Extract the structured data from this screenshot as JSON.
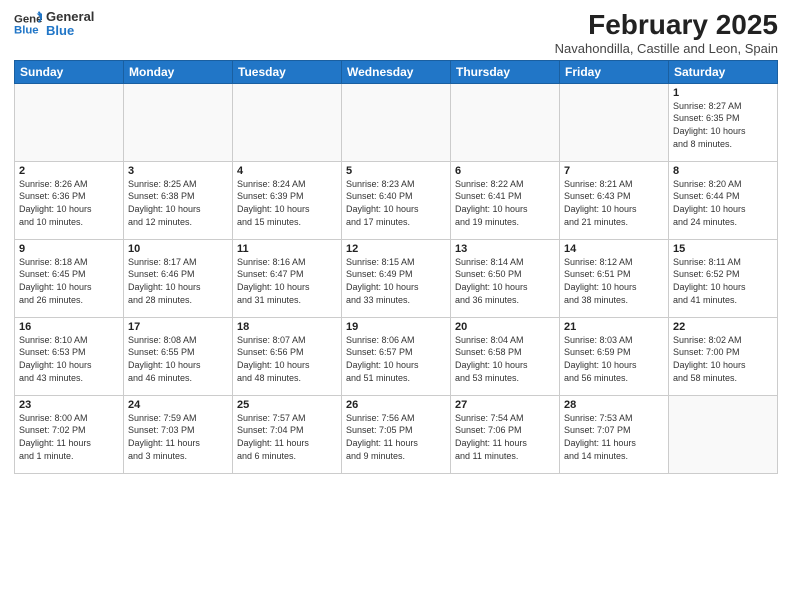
{
  "logo": {
    "line1": "General",
    "line2": "Blue"
  },
  "title": "February 2025",
  "subtitle": "Navahondilla, Castille and Leon, Spain",
  "weekdays": [
    "Sunday",
    "Monday",
    "Tuesday",
    "Wednesday",
    "Thursday",
    "Friday",
    "Saturday"
  ],
  "weeks": [
    [
      {
        "day": "",
        "info": ""
      },
      {
        "day": "",
        "info": ""
      },
      {
        "day": "",
        "info": ""
      },
      {
        "day": "",
        "info": ""
      },
      {
        "day": "",
        "info": ""
      },
      {
        "day": "",
        "info": ""
      },
      {
        "day": "1",
        "info": "Sunrise: 8:27 AM\nSunset: 6:35 PM\nDaylight: 10 hours\nand 8 minutes."
      }
    ],
    [
      {
        "day": "2",
        "info": "Sunrise: 8:26 AM\nSunset: 6:36 PM\nDaylight: 10 hours\nand 10 minutes."
      },
      {
        "day": "3",
        "info": "Sunrise: 8:25 AM\nSunset: 6:38 PM\nDaylight: 10 hours\nand 12 minutes."
      },
      {
        "day": "4",
        "info": "Sunrise: 8:24 AM\nSunset: 6:39 PM\nDaylight: 10 hours\nand 15 minutes."
      },
      {
        "day": "5",
        "info": "Sunrise: 8:23 AM\nSunset: 6:40 PM\nDaylight: 10 hours\nand 17 minutes."
      },
      {
        "day": "6",
        "info": "Sunrise: 8:22 AM\nSunset: 6:41 PM\nDaylight: 10 hours\nand 19 minutes."
      },
      {
        "day": "7",
        "info": "Sunrise: 8:21 AM\nSunset: 6:43 PM\nDaylight: 10 hours\nand 21 minutes."
      },
      {
        "day": "8",
        "info": "Sunrise: 8:20 AM\nSunset: 6:44 PM\nDaylight: 10 hours\nand 24 minutes."
      }
    ],
    [
      {
        "day": "9",
        "info": "Sunrise: 8:18 AM\nSunset: 6:45 PM\nDaylight: 10 hours\nand 26 minutes."
      },
      {
        "day": "10",
        "info": "Sunrise: 8:17 AM\nSunset: 6:46 PM\nDaylight: 10 hours\nand 28 minutes."
      },
      {
        "day": "11",
        "info": "Sunrise: 8:16 AM\nSunset: 6:47 PM\nDaylight: 10 hours\nand 31 minutes."
      },
      {
        "day": "12",
        "info": "Sunrise: 8:15 AM\nSunset: 6:49 PM\nDaylight: 10 hours\nand 33 minutes."
      },
      {
        "day": "13",
        "info": "Sunrise: 8:14 AM\nSunset: 6:50 PM\nDaylight: 10 hours\nand 36 minutes."
      },
      {
        "day": "14",
        "info": "Sunrise: 8:12 AM\nSunset: 6:51 PM\nDaylight: 10 hours\nand 38 minutes."
      },
      {
        "day": "15",
        "info": "Sunrise: 8:11 AM\nSunset: 6:52 PM\nDaylight: 10 hours\nand 41 minutes."
      }
    ],
    [
      {
        "day": "16",
        "info": "Sunrise: 8:10 AM\nSunset: 6:53 PM\nDaylight: 10 hours\nand 43 minutes."
      },
      {
        "day": "17",
        "info": "Sunrise: 8:08 AM\nSunset: 6:55 PM\nDaylight: 10 hours\nand 46 minutes."
      },
      {
        "day": "18",
        "info": "Sunrise: 8:07 AM\nSunset: 6:56 PM\nDaylight: 10 hours\nand 48 minutes."
      },
      {
        "day": "19",
        "info": "Sunrise: 8:06 AM\nSunset: 6:57 PM\nDaylight: 10 hours\nand 51 minutes."
      },
      {
        "day": "20",
        "info": "Sunrise: 8:04 AM\nSunset: 6:58 PM\nDaylight: 10 hours\nand 53 minutes."
      },
      {
        "day": "21",
        "info": "Sunrise: 8:03 AM\nSunset: 6:59 PM\nDaylight: 10 hours\nand 56 minutes."
      },
      {
        "day": "22",
        "info": "Sunrise: 8:02 AM\nSunset: 7:00 PM\nDaylight: 10 hours\nand 58 minutes."
      }
    ],
    [
      {
        "day": "23",
        "info": "Sunrise: 8:00 AM\nSunset: 7:02 PM\nDaylight: 11 hours\nand 1 minute."
      },
      {
        "day": "24",
        "info": "Sunrise: 7:59 AM\nSunset: 7:03 PM\nDaylight: 11 hours\nand 3 minutes."
      },
      {
        "day": "25",
        "info": "Sunrise: 7:57 AM\nSunset: 7:04 PM\nDaylight: 11 hours\nand 6 minutes."
      },
      {
        "day": "26",
        "info": "Sunrise: 7:56 AM\nSunset: 7:05 PM\nDaylight: 11 hours\nand 9 minutes."
      },
      {
        "day": "27",
        "info": "Sunrise: 7:54 AM\nSunset: 7:06 PM\nDaylight: 11 hours\nand 11 minutes."
      },
      {
        "day": "28",
        "info": "Sunrise: 7:53 AM\nSunset: 7:07 PM\nDaylight: 11 hours\nand 14 minutes."
      },
      {
        "day": "",
        "info": ""
      }
    ]
  ]
}
